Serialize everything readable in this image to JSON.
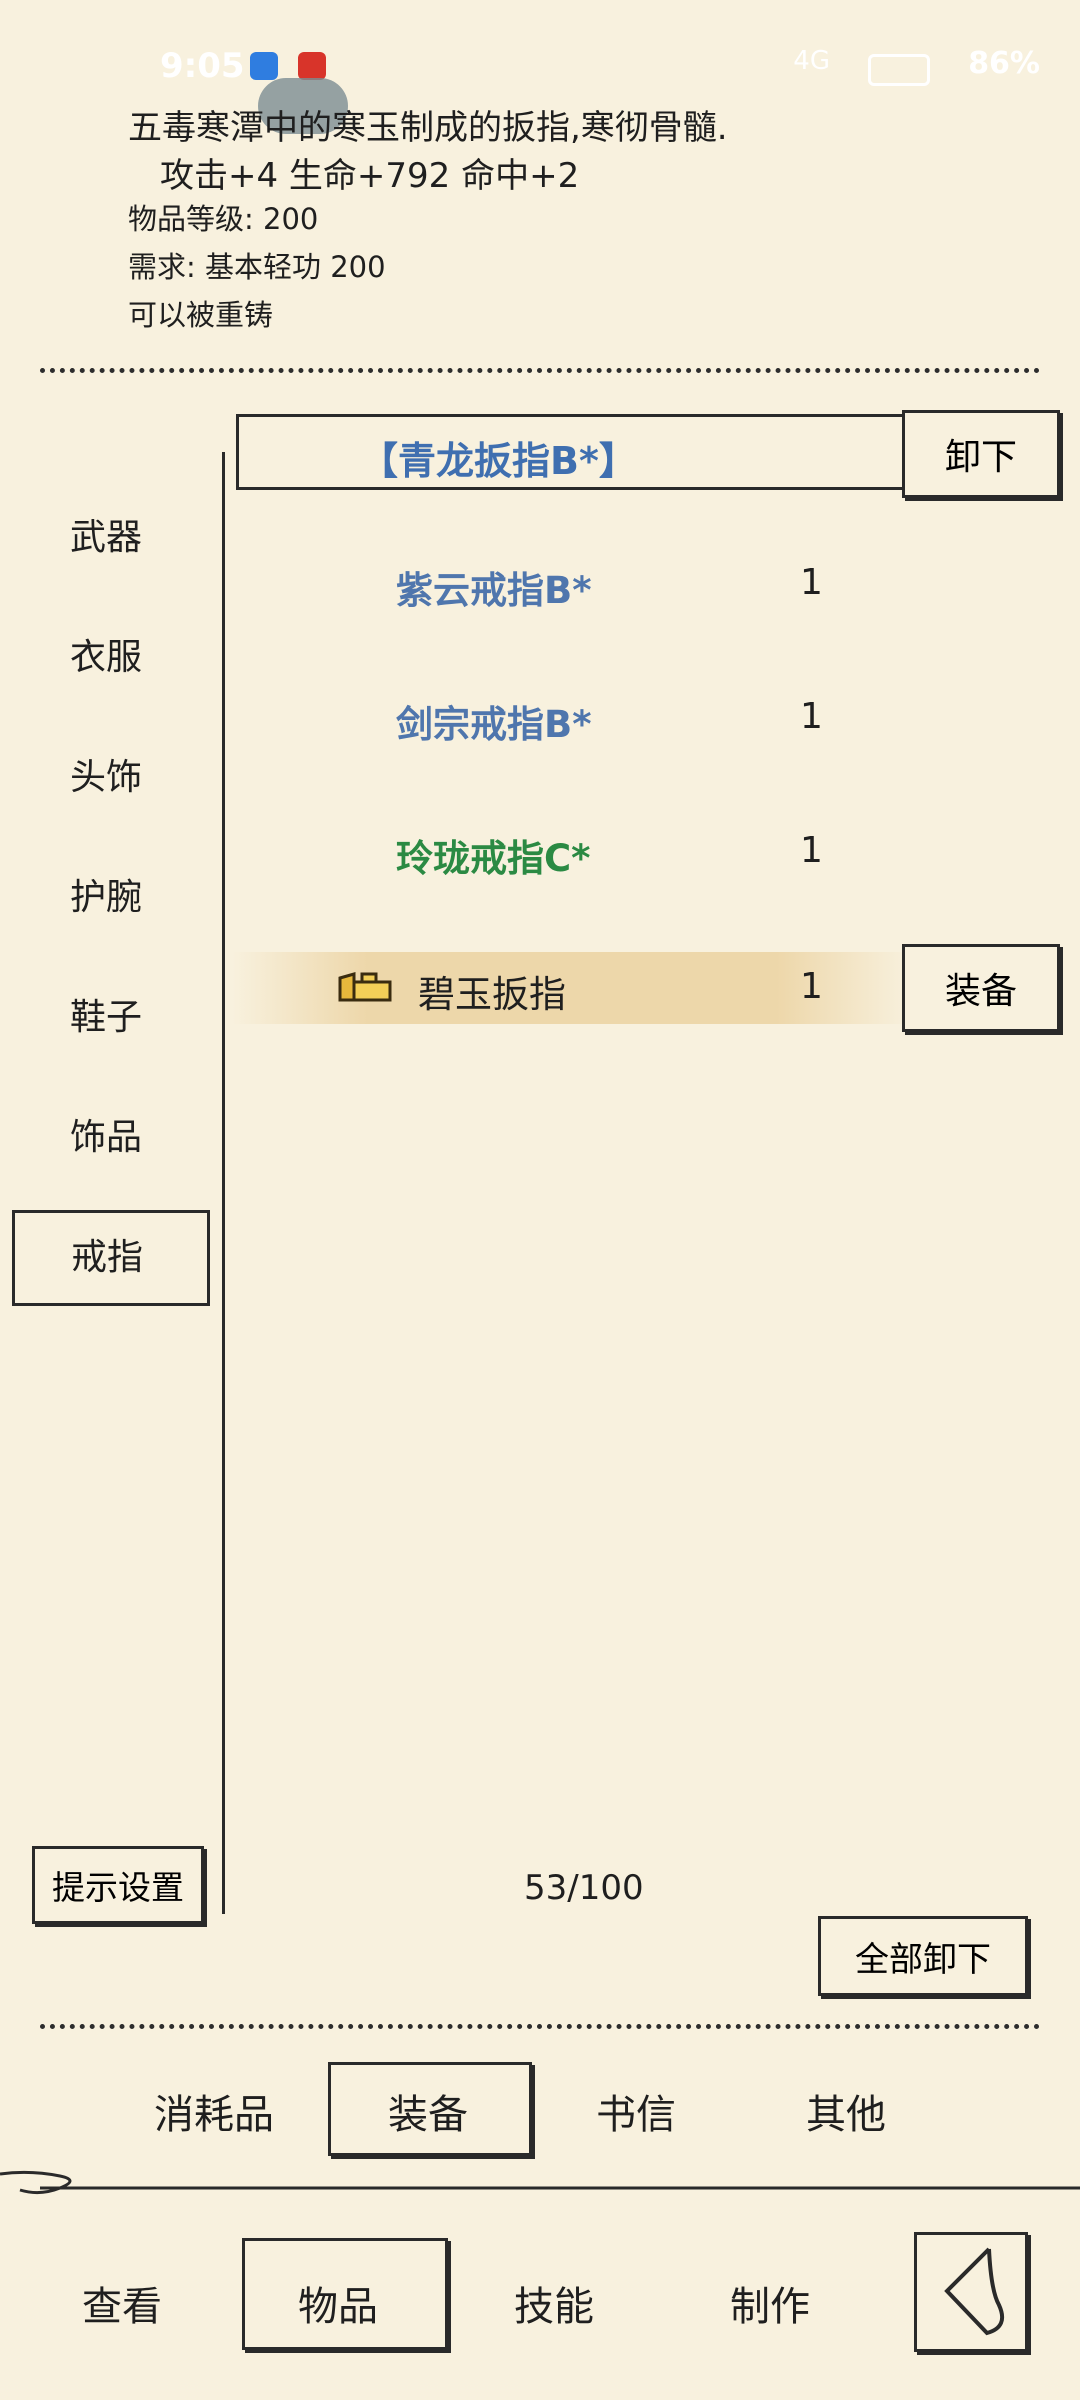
{
  "status_bar": {
    "time": "9:05",
    "battery": "86%",
    "network": "4G"
  },
  "description": {
    "text": "五毒寒潭中的寒玉制成的扳指,寒彻骨髓.",
    "stats": "攻击+4 生命+792 命中+2",
    "level": "物品等级:  200",
    "requirement": "需求:   基本轻功 200",
    "reforge": "可以被重铸"
  },
  "sidebar": {
    "items": [
      {
        "label": "武器"
      },
      {
        "label": "衣服"
      },
      {
        "label": "头饰"
      },
      {
        "label": "护腕"
      },
      {
        "label": "鞋子"
      },
      {
        "label": "饰品"
      },
      {
        "label": "戒指",
        "active": true
      }
    ],
    "hint_settings": "提示设置"
  },
  "equipped": {
    "name": "【青龙扳指B*】",
    "unequip_label": "卸下"
  },
  "items": [
    {
      "name": "紫云戒指B*",
      "qty": "1",
      "color": "#4f76ad"
    },
    {
      "name": "剑宗戒指B*",
      "qty": "1",
      "color": "#4f76ad"
    },
    {
      "name": "玲珑戒指C*",
      "qty": "1",
      "color": "#2b8a43"
    },
    {
      "name": "碧玉扳指",
      "qty": "1",
      "color": "#1f1f1f",
      "icon": "jade-ring-icon",
      "equip_label": "装备"
    }
  ],
  "capacity": "53/100",
  "unequip_all_label": "全部卸下",
  "category_tabs": [
    {
      "label": "消耗品"
    },
    {
      "label": "装备",
      "active": true
    },
    {
      "label": "书信"
    },
    {
      "label": "其他"
    }
  ],
  "bottom_nav": [
    {
      "label": "查看"
    },
    {
      "label": "物品",
      "active": true
    },
    {
      "label": "技能"
    },
    {
      "label": "制作"
    }
  ],
  "back_icon": "back-arrow-icon"
}
